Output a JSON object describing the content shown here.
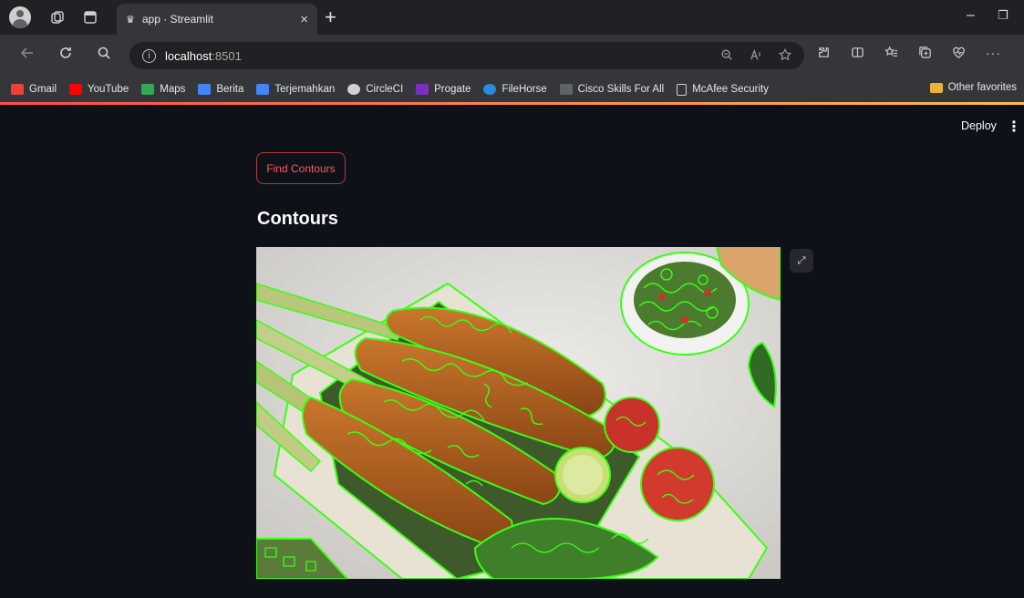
{
  "browser": {
    "tab": {
      "title": "app · Streamlit",
      "favicon": "crown-icon",
      "close": "×"
    },
    "new_tab": "+",
    "window": {
      "minimize": "–",
      "restore": "❐"
    },
    "address": {
      "host": "localhost",
      "port": ":8501"
    },
    "bookmarks": [
      {
        "label": "Gmail",
        "color": "#ea4335"
      },
      {
        "label": "YouTube",
        "color": "#ff0000"
      },
      {
        "label": "Maps",
        "color": "#34a853"
      },
      {
        "label": "Berita",
        "color": "#4285f4"
      },
      {
        "label": "Terjemahkan",
        "color": "#4285f4"
      },
      {
        "label": "CircleCI",
        "color": "#d0d0d0"
      },
      {
        "label": "Progate",
        "color": "#7b2fbe"
      },
      {
        "label": "FileHorse",
        "color": "#2a8ae0"
      },
      {
        "label": "Cisco Skills For All",
        "color": "#5f6368"
      },
      {
        "label": "McAfee Security",
        "color": "#d0d0d0"
      }
    ],
    "other_favorites": "Other favorites"
  },
  "app": {
    "deploy_label": "Deploy",
    "menu_glyph": "⋮",
    "button_label": "Find Contours",
    "section_title": "Contours",
    "fullscreen_glyph": "⤢",
    "accent_color": "#ff4b4b",
    "contour_color": "#39ff14"
  }
}
